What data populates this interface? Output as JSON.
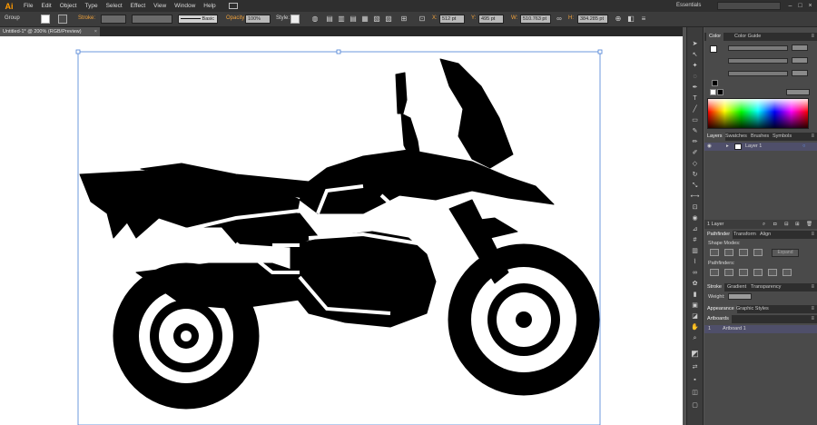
{
  "app": {
    "logo": "Ai",
    "workspace": "Essentials"
  },
  "menu": [
    "File",
    "Edit",
    "Object",
    "Type",
    "Select",
    "Effect",
    "View",
    "Window",
    "Help"
  ],
  "controlbar": {
    "selection": "Group",
    "stroke_label": "Stroke:",
    "brush": "Basic",
    "opacity_label": "Opacity:",
    "opacity_value": "100%",
    "style_label": "Style:",
    "x_label": "X:",
    "x_value": "512 pt",
    "y_label": "Y:",
    "y_value": "495 pt",
    "w_label": "W:",
    "w_value": "510.763 pt",
    "h_label": "H:",
    "h_value": "384.285 pt"
  },
  "document": {
    "tab_title": "Untitled-1* @ 200% (RGB/Preview)",
    "close": "×"
  },
  "panels": {
    "color_tabs": [
      "Color",
      "Color Guide"
    ],
    "layers_tabs": [
      "Layers",
      "Swatches",
      "Brushes",
      "Symbols"
    ],
    "layer_name": "Layer 1",
    "layers_count": "1 Layer",
    "pathfinder_tabs": [
      "Pathfinder",
      "Transform",
      "Align"
    ],
    "shape_modes": "Shape Modes:",
    "expand": "Expand",
    "pathfinders": "Pathfinders:",
    "stroke_tabs": [
      "Stroke",
      "Gradient",
      "Transparency"
    ],
    "weight_label": "Weight:",
    "appearance_tabs": [
      "Appearance",
      "Graphic Styles"
    ],
    "artboards_tab": "Artboards",
    "artboard_index": "1",
    "artboard_name": "Artboard 1"
  },
  "icons": [
    "selection-tool",
    "direct-selection",
    "magic-wand",
    "lasso",
    "pen",
    "type",
    "line",
    "rectangle",
    "paintbrush",
    "pencil",
    "blob-brush",
    "eraser",
    "rotate",
    "scale",
    "width",
    "free-transform",
    "shape-builder",
    "perspective-grid",
    "mesh",
    "gradient",
    "eyedropper",
    "blend",
    "symbol-sprayer",
    "column-graph",
    "artboard",
    "slice",
    "hand",
    "zoom",
    "fill-stroke",
    "screen-mode"
  ],
  "colors": {
    "accent": "#ff9a00",
    "selection": "#4a7fd4",
    "layer_highlight": "#4f4f6a"
  }
}
